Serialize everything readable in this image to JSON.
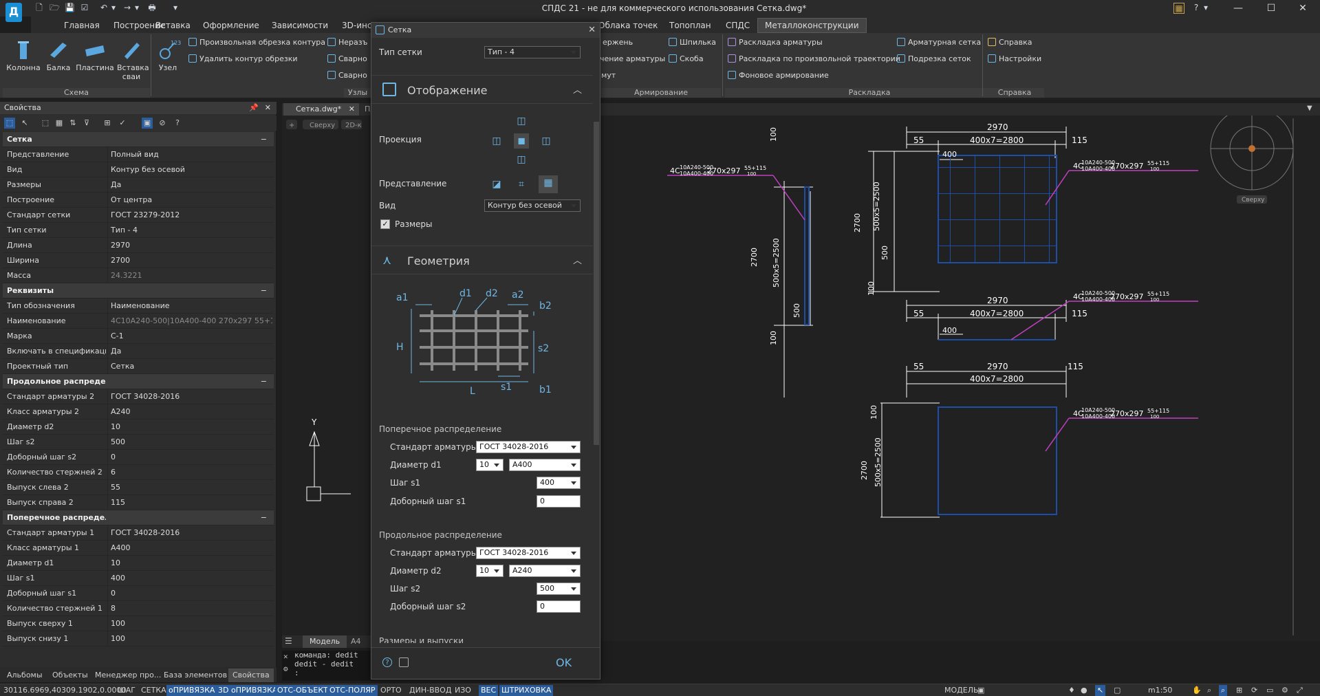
{
  "window": {
    "title": "СПДС 21 - не для коммерческого использования Сетка.dwg*",
    "help_label": "?"
  },
  "ribbon": {
    "tabs": [
      "Главная",
      "Построение",
      "Вставка",
      "Оформление",
      "Зависимости",
      "3D-инс",
      "Облака точек",
      "Топоплан",
      "СПДС",
      "Металлоконструкции"
    ],
    "groups": {
      "schema": "Схема",
      "node_group": "Узлы",
      "armirovanie": "Армирование",
      "raskladka": "Раскладка",
      "spravka": "Справка"
    },
    "big": {
      "kolonna": "Колонна",
      "balka": "Балка",
      "plastina": "Пластина",
      "vstavka": "Вставка сваи",
      "uzel": "Узел",
      "uzel_num": "123"
    },
    "small": {
      "obrezka": "Произвольная обрезка контура",
      "udalit": "Удалить контур обрезки",
      "neraz": "Неразъ",
      "svar1": "Сварно",
      "svar2": "Сварно",
      "sterzh": "ержень",
      "chenie": "чение арматуры",
      "mut": "мут",
      "shpilka": "Шпилька",
      "skoba": "Скоба",
      "rask_arm": "Раскладка арматуры",
      "rask_traj": "Раскладка по произвольной траектории",
      "fon": "Фоновое армирование",
      "arm_setka": "Арматурная сетка",
      "podrezka": "Подрезка сеток",
      "spravka": "Справка",
      "nastroiki": "Настройки"
    }
  },
  "props": {
    "title": "Свойства",
    "sections": [
      {
        "name": "Сетка",
        "rows": [
          [
            "Представление",
            "Полный вид"
          ],
          [
            "Вид",
            "Контур без осевой"
          ],
          [
            "Размеры",
            "Да"
          ],
          [
            "Построение",
            "От центра"
          ],
          [
            "Стандарт сетки",
            "ГОСТ 23279-2012"
          ],
          [
            "Тип сетки",
            "Тип - 4"
          ],
          [
            "Длина",
            "2970"
          ],
          [
            "Ширина",
            "2700"
          ],
          [
            "Масса",
            "24.3221"
          ]
        ]
      },
      {
        "name": "Реквизиты",
        "rows": [
          [
            "Тип обозначения",
            "Наименование"
          ],
          [
            "Наименование",
            "4С10А240-500|10А400-400 270x297 55+115|..."
          ],
          [
            "Марка",
            "С-1"
          ],
          [
            "Включать в спецификацию",
            "Да"
          ],
          [
            "Проектный тип",
            "Сетка"
          ]
        ]
      },
      {
        "name": "Продольное распределение",
        "rows": [
          [
            "Стандарт арматуры 2",
            "ГОСТ 34028-2016"
          ],
          [
            "Класс арматуры 2",
            "А240"
          ],
          [
            "Диаметр d2",
            "10"
          ],
          [
            "Шаг s2",
            "500"
          ],
          [
            "Доборный шаг s2",
            "0"
          ],
          [
            "Количество стержней 2",
            "6"
          ],
          [
            "Выпуск слева 2",
            "55"
          ],
          [
            "Выпуск справа 2",
            "115"
          ]
        ]
      },
      {
        "name": "Поперечное распределение",
        "rows": [
          [
            "Стандарт арматуры 1",
            "ГОСТ 34028-2016"
          ],
          [
            "Класс арматуры 1",
            "А400"
          ],
          [
            "Диаметр d1",
            "10"
          ],
          [
            "Шаг s1",
            "400"
          ],
          [
            "Доборный шаг s1",
            "0"
          ],
          [
            "Количество стержней 1",
            "8"
          ],
          [
            "Выпуск сверху 1",
            "100"
          ],
          [
            "Выпуск снизу 1",
            "100"
          ]
        ]
      }
    ],
    "bottom_tabs": [
      "Альбомы",
      "Объекты",
      "Менеджер про...",
      "База элементов",
      "Свойства"
    ]
  },
  "doc": {
    "tab": "Сетка.dwg*",
    "tab2": "Пл",
    "view_btn": "Сверху",
    "view_btn2": "2D-к",
    "model_tab": "Модель",
    "a4_tab": "А4",
    "viewcube_label": "Сверху",
    "axis_y": "Y"
  },
  "cmd": {
    "line1": "команда: dedit",
    "line2": "dedit - dedit",
    "line3": ":"
  },
  "status": {
    "coords": "30116.6969,40309.1902,0.0000",
    "items": [
      "ШАГ",
      "СЕТКА",
      "оПРИВЯЗКА",
      "3D оПРИВЯЗКА",
      "ОТС-ОБЪЕКТ",
      "ОТС-ПОЛЯР",
      "ОРТО",
      "ДИН-ВВОД",
      "ИЗО",
      "ВЕС",
      "ШТРИХОВКА"
    ],
    "model": "МОДЕЛЬ",
    "scale": "m1:50"
  },
  "dialog": {
    "title": "Сетка",
    "type_label": "Тип сетки",
    "type_value": "Тип - 4",
    "display_header": "Отображение",
    "proj_label": "Проекция",
    "repr_label": "Представление",
    "view_label": "Вид",
    "view_value": "Контур без осевой",
    "dims_label": "Размеры",
    "geom_header": "Геометрия",
    "diagram": {
      "a1": "a1",
      "d1": "d1",
      "d2": "d2",
      "a2": "a2",
      "b2": "b2",
      "H": "H",
      "s2": "s2",
      "s1": "s1",
      "L": "L",
      "b1": "b1"
    },
    "cross_header": "Поперечное распределение",
    "std1_label": "Стандарт арматуры 1",
    "std1_value": "ГОСТ 34028-2016",
    "d1_label": "Диаметр d1",
    "d1_value": "10",
    "cls1_value": "А400",
    "s1_label": "Шаг s1",
    "s1_value": "400",
    "add1_label": "Доборный шаг s1",
    "add1_value": "0",
    "long_header": "Продольное распределение",
    "std2_label": "Стандарт арматуры 2",
    "std2_value": "ГОСТ 34028-2016",
    "d2_label": "Диаметр d2",
    "d2_value": "10",
    "cls2_value": "А240",
    "s2_label": "Шаг s2",
    "s2_value": "500",
    "add2_label": "Доборный шаг s2",
    "add2_value": "0",
    "dims_header": "Размеры и выпуски",
    "ok": "OK"
  },
  "drawing": {
    "dim_2970": "2970",
    "dim_400x7": "400x7=2800",
    "dim_55": "55",
    "dim_115": "115",
    "dim_400": "400",
    "dim_100": "100",
    "dim_2700": "2700",
    "dim_500x5": "500x5=2500",
    "dim_500": "500",
    "mark_4c": "4С",
    "mark_top": "10А240-500",
    "mark_bot": "10А400-400",
    "mark_size": "270x297",
    "mark_fr_top": "55+115",
    "mark_fr_bot": "100"
  }
}
